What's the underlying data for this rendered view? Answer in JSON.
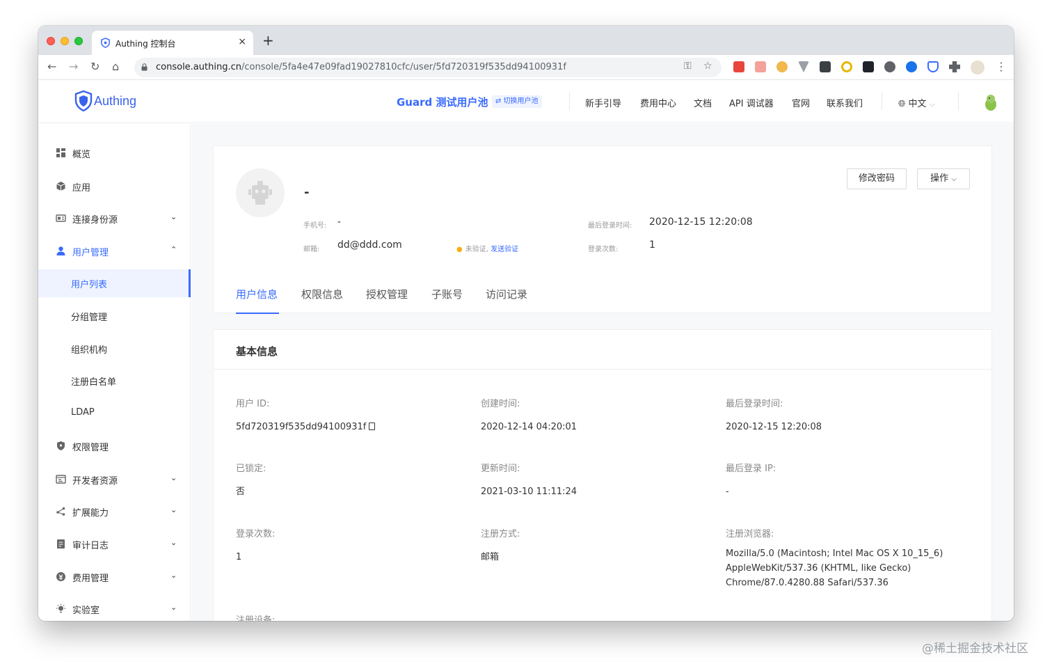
{
  "browser": {
    "tab_title": "Authing 控制台",
    "url_host": "console.authing.cn",
    "url_path": "/console/5fa4e47e09fad19027810cfc/user/5fd720319f535dd94100931f",
    "new_tab": "+",
    "close": "×"
  },
  "header": {
    "logo_text": "Authing",
    "pool_name": "Guard 测试用户池",
    "switch_pool": "⇄ 切换用户池",
    "nav": [
      "新手引导",
      "费用中心",
      "文档",
      "API 调试器",
      "官网",
      "联系我们"
    ],
    "language": "中文"
  },
  "sidebar": {
    "items": [
      {
        "label": "概览",
        "icon": "dashboard-icon"
      },
      {
        "label": "应用",
        "icon": "app-cube-icon"
      },
      {
        "label": "连接身份源",
        "icon": "identity-source-icon",
        "expandable": true
      },
      {
        "label": "用户管理",
        "icon": "user-icon",
        "expanded": true
      },
      {
        "label": "权限管理",
        "icon": "shield-icon"
      },
      {
        "label": "开发者资源",
        "icon": "developer-icon",
        "expandable": true
      },
      {
        "label": "扩展能力",
        "icon": "extension-icon",
        "expandable": true
      },
      {
        "label": "审计日志",
        "icon": "audit-log-icon",
        "expandable": true
      },
      {
        "label": "费用管理",
        "icon": "billing-icon",
        "expandable": true
      },
      {
        "label": "实验室",
        "icon": "lab-bulb-icon",
        "expandable": true
      }
    ],
    "sub_items": [
      "用户列表",
      "分组管理",
      "组织机构",
      "注册白名单",
      "LDAP"
    ],
    "active_sub": "用户列表"
  },
  "profile": {
    "name": "-",
    "phone_label": "手机号:",
    "phone_value": "-",
    "email_label": "邮箱:",
    "email_value": "dd@ddd.com",
    "verify_status": "未验证,",
    "verify_link": "发送验证",
    "last_login_label": "最后登录时间:",
    "last_login_value": "2020-12-15 12:20:08",
    "login_count_label": "登录次数:",
    "login_count_value": "1",
    "change_password_button": "修改密码",
    "actions_button": "操作"
  },
  "tabs": [
    "用户信息",
    "权限信息",
    "授权管理",
    "子账号",
    "访问记录"
  ],
  "active_tab": "用户信息",
  "basic_info": {
    "title": "基本信息",
    "fields": [
      {
        "label": "用户 ID:",
        "value": "5fd720319f535dd94100931f"
      },
      {
        "label": "创建时间:",
        "value": "2020-12-14 04:20:01"
      },
      {
        "label": "最后登录时间:",
        "value": "2020-12-15 12:20:08"
      },
      {
        "label": "已锁定:",
        "value": "否"
      },
      {
        "label": "更新时间:",
        "value": "2021-03-10 11:11:24"
      },
      {
        "label": "最后登录 IP:",
        "value": "-"
      },
      {
        "label": "登录次数:",
        "value": "1"
      },
      {
        "label": "注册方式:",
        "value": "邮箱"
      },
      {
        "label": "注册浏览器:",
        "value_lines": [
          "Mozilla/5.0 (Macintosh; Intel Mac OS X 10_15_6)",
          "AppleWebKit/537.36 (KHTML, like Gecko)",
          "Chrome/87.0.4280.88 Safari/537.36"
        ]
      },
      {
        "label": "注册设备:",
        "value": ""
      }
    ]
  },
  "watermark": "@稀土掘金技术社区",
  "colors": {
    "primary": "#396aff",
    "warning_dot": "#faad14"
  }
}
